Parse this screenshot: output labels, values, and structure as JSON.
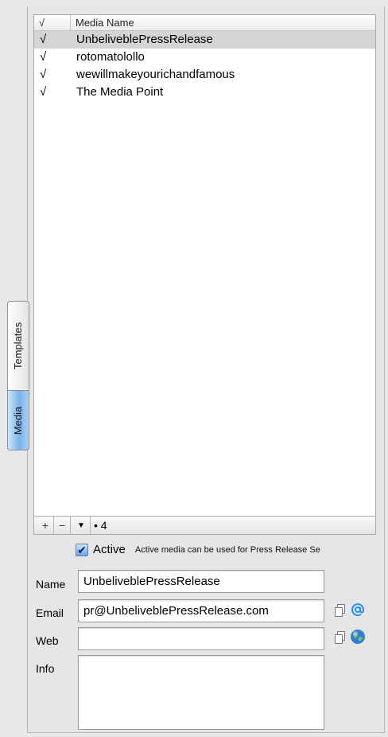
{
  "sidebar_tabs": [
    {
      "label": "Templates",
      "selected": false
    },
    {
      "label": "Media",
      "selected": true
    }
  ],
  "table": {
    "columns": [
      "√",
      "Media Name"
    ],
    "rows": [
      {
        "check": "√",
        "name": "UnbeliveblePressRelease",
        "selected": true
      },
      {
        "check": "√",
        "name": "rotomatolollo",
        "selected": false
      },
      {
        "check": "√",
        "name": "wewillmakeyourichandfamous",
        "selected": false
      },
      {
        "check": "√",
        "name": "The Media Point",
        "selected": false
      }
    ]
  },
  "bottombar": {
    "add_label": "+",
    "remove_label": "−",
    "menu_label": "▼",
    "count": "• 4"
  },
  "active": {
    "checked": true,
    "check_glyph": "✔",
    "label": "Active",
    "hint": "Active media can be used for Press Release Se"
  },
  "form": {
    "name_label": "Name",
    "name_value": "UnbeliveblePressRelease",
    "email_label": "Email",
    "email_value": "pr@UnbeliveblePressRelease.com",
    "web_label": "Web",
    "web_value": "",
    "info_label": "Info",
    "info_value": ""
  },
  "icons": {
    "copy": "copy-icon",
    "mail": "mail-at-icon",
    "globe": "globe-icon"
  },
  "colors": {
    "selected_tab": "#79b2ea",
    "selected_row": "#d4d4d4",
    "mail_blue": "#2e8af0"
  }
}
